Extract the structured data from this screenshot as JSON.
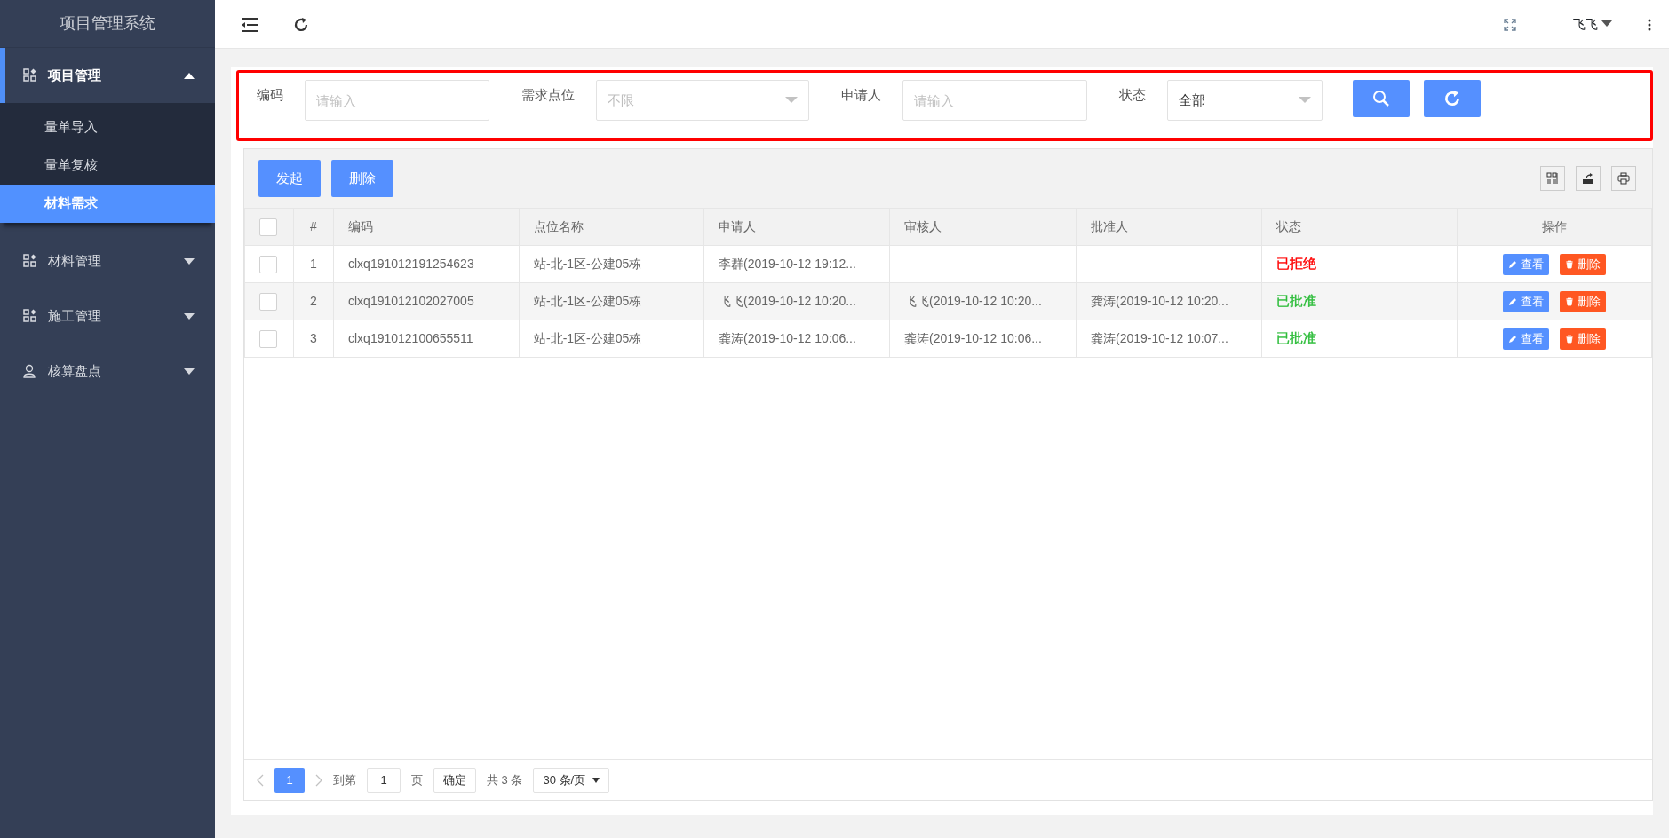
{
  "sidebar": {
    "title": "项目管理系统",
    "menu": [
      {
        "label": "项目管理",
        "kind": "grid",
        "expanded": true,
        "selected": true,
        "children": [
          {
            "label": "量单导入",
            "selected": false
          },
          {
            "label": "量单复核",
            "selected": false
          },
          {
            "label": "材料需求",
            "selected": true
          }
        ]
      },
      {
        "label": "材料管理",
        "kind": "grid",
        "expanded": false,
        "selected": false
      },
      {
        "label": "施工管理",
        "kind": "grid",
        "expanded": false,
        "selected": false
      },
      {
        "label": "核算盘点",
        "kind": "person",
        "expanded": false,
        "selected": false
      }
    ]
  },
  "topbar": {
    "user": "飞飞"
  },
  "filters": [
    {
      "label": "编码",
      "kind": "input",
      "placeholder": "请输入"
    },
    {
      "label": "需求点位",
      "kind": "select",
      "placeholder": "不限"
    },
    {
      "label": "申请人",
      "kind": "input",
      "placeholder": "请输入"
    },
    {
      "label": "状态",
      "kind": "select",
      "value": "全部"
    }
  ],
  "toolbar": {
    "buttons": [
      "发起",
      "删除"
    ]
  },
  "table": {
    "header_checked": false,
    "columns": [
      "#",
      "编码",
      "点位名称",
      "申请人",
      "审核人",
      "批准人",
      "状态",
      "操作"
    ],
    "rows": [
      {
        "checked": false,
        "index": "1",
        "code": "clxq191012191254623",
        "location": "站-北-1区-公建05栋",
        "applicant": "李群(2019-10-12 19:12...",
        "reviewer": "",
        "approver": "",
        "status": "已拒绝",
        "color": "#ff0000",
        "actions": [
          "查看",
          "删除"
        ]
      },
      {
        "checked": false,
        "index": "2",
        "code": "clxq191012102027005",
        "location": "站-北-1区-公建05栋",
        "applicant": "飞飞(2019-10-12 10:20...",
        "reviewer": "飞飞(2019-10-12 10:20...",
        "approver": "龚涛(2019-10-12 10:20...",
        "status": "已批准",
        "color": "#2dbd3a",
        "actions": [
          "查看",
          "删除"
        ]
      },
      {
        "checked": false,
        "index": "3",
        "code": "clxq191012100655511",
        "location": "站-北-1区-公建05栋",
        "applicant": "龚涛(2019-10-12 10:06...",
        "reviewer": "龚涛(2019-10-12 10:06...",
        "approver": "龚涛(2019-10-12 10:07...",
        "status": "已批准",
        "color": "#2dbd3a",
        "actions": [
          "查看",
          "删除"
        ]
      }
    ]
  },
  "pagination": {
    "pages": [
      {
        "label": "1",
        "selected": true
      }
    ],
    "goto_label": "到第",
    "goto_value": "1",
    "page_unit": "页",
    "confirm": "确定",
    "total": "共 3 条",
    "page_size": "30 条/页"
  }
}
